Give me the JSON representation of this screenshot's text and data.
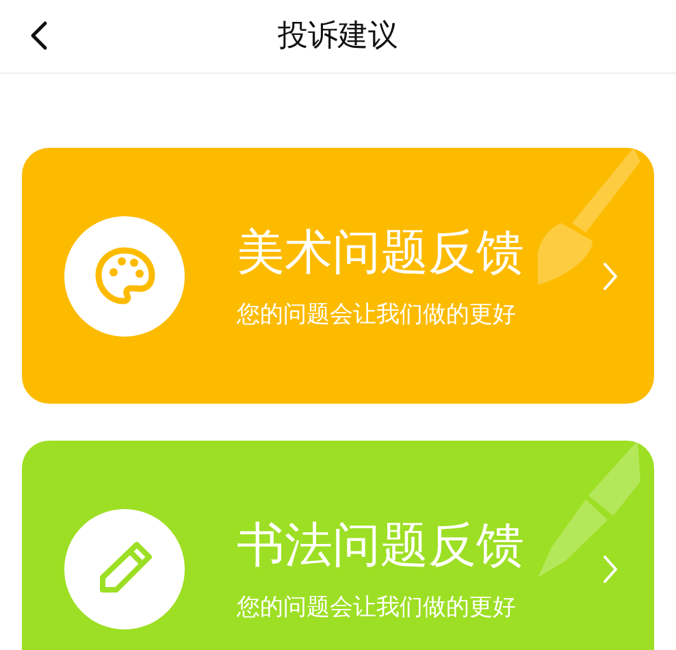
{
  "header": {
    "title": "投诉建议"
  },
  "cards": [
    {
      "kind": "art",
      "color": "#fdbb00",
      "title": "美术问题反馈",
      "subtitle": "您的问题会让我们做的更好"
    },
    {
      "kind": "calligraphy",
      "color": "#9ddf24",
      "title": "书法问题反馈",
      "subtitle": "您的问题会让我们做的更好"
    }
  ]
}
